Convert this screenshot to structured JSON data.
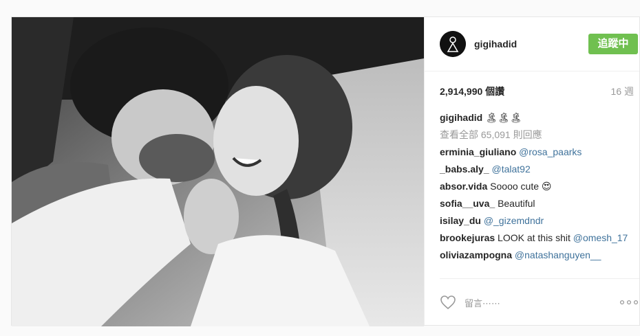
{
  "post": {
    "username": "gigihadid",
    "follow_label": "追蹤中",
    "likes_label": "2,914,990 個讚",
    "age_label": "16 週",
    "caption": {
      "user": "gigihadid",
      "text": "🏝🏝🏝"
    },
    "view_all_label": "查看全部 65,091 則回應",
    "comments": [
      {
        "user": "erminia_giuliano",
        "text": "",
        "mention": "@rosa_paarks"
      },
      {
        "user": "_babs.aly_",
        "text": "",
        "mention": "@talat92"
      },
      {
        "user": "absor.vida",
        "text": "Soooo cute 😍",
        "mention": ""
      },
      {
        "user": "sofia__uva_",
        "text": "Beautiful",
        "mention": ""
      },
      {
        "user": "isilay_du",
        "text": "",
        "mention": "@_gizemdndr"
      },
      {
        "user": "brookejuras",
        "text": "LOOK at this shit",
        "mention": "@omesh_17"
      },
      {
        "user": "oliviazampogna",
        "text": "",
        "mention": "@natashanguyen__"
      }
    ],
    "add_comment_placeholder": "留言⋯⋯",
    "icons": {
      "like": "heart-icon",
      "more": "more-options-icon",
      "avatar": "profile-avatar"
    },
    "colors": {
      "follow_bg": "#70c050",
      "mention": "#3f729b",
      "muted": "#999999"
    }
  }
}
